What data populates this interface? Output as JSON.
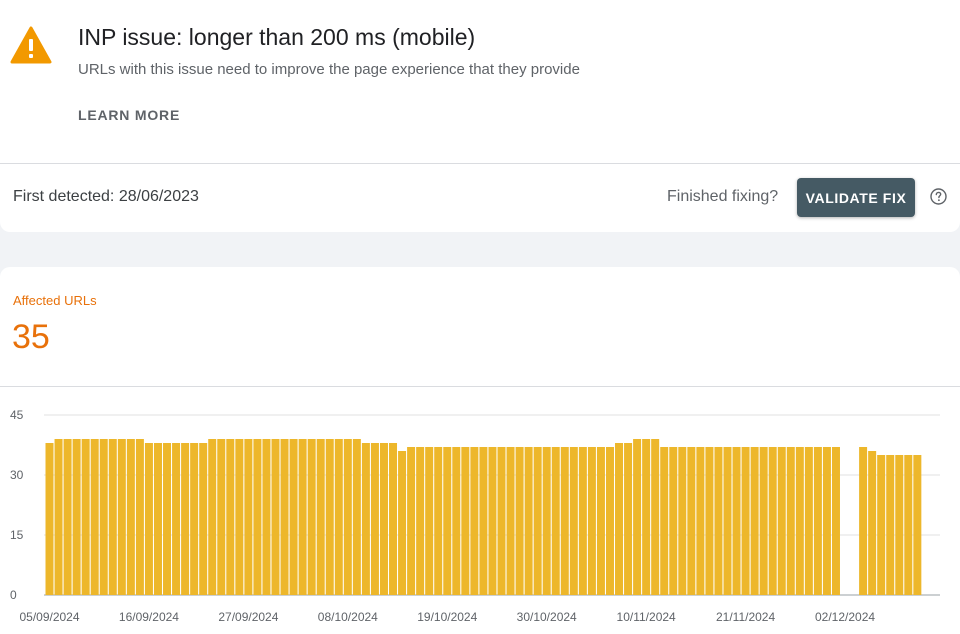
{
  "header": {
    "title": "INP issue: longer than 200 ms (mobile)",
    "subtitle": "URLs with this issue need to improve the page experience that they provide",
    "learn_more": "LEARN MORE",
    "icon": "warning-triangle-icon",
    "warning_color": "#f29900"
  },
  "status": {
    "first_detected": "First detected: 28/06/2023",
    "finished_prompt": "Finished fixing?",
    "validate_label": "VALIDATE FIX",
    "help_icon": "help-circle-icon"
  },
  "metric": {
    "label": "Affected URLs",
    "value": "35",
    "color": "#e8710a"
  },
  "chart_data": {
    "type": "bar",
    "bar_color": "#edb72b",
    "start_date": "05/09/2024",
    "ylim": [
      0,
      45
    ],
    "yticks": [
      0,
      15,
      30,
      45
    ],
    "xtick_labels": [
      "05/09/2024",
      "16/09/2024",
      "27/09/2024",
      "08/10/2024",
      "19/10/2024",
      "30/10/2024",
      "10/11/2024",
      "21/11/2024",
      "02/12/2024"
    ],
    "values": [
      38,
      39,
      39,
      39,
      39,
      39,
      39,
      39,
      39,
      39,
      39,
      38,
      38,
      38,
      38,
      38,
      38,
      38,
      39,
      39,
      39,
      39,
      39,
      39,
      39,
      39,
      39,
      39,
      39,
      39,
      39,
      39,
      39,
      39,
      39,
      38,
      38,
      38,
      38,
      36,
      37,
      37,
      37,
      37,
      37,
      37,
      37,
      37,
      37,
      37,
      37,
      37,
      37,
      37,
      37,
      37,
      37,
      37,
      37,
      37,
      37,
      37,
      37,
      38,
      38,
      39,
      39,
      39,
      37,
      37,
      37,
      37,
      37,
      37,
      37,
      37,
      37,
      37,
      37,
      37,
      37,
      37,
      37,
      37,
      37,
      37,
      37,
      37,
      null,
      null,
      37,
      36,
      35,
      35,
      35,
      35,
      35
    ]
  }
}
